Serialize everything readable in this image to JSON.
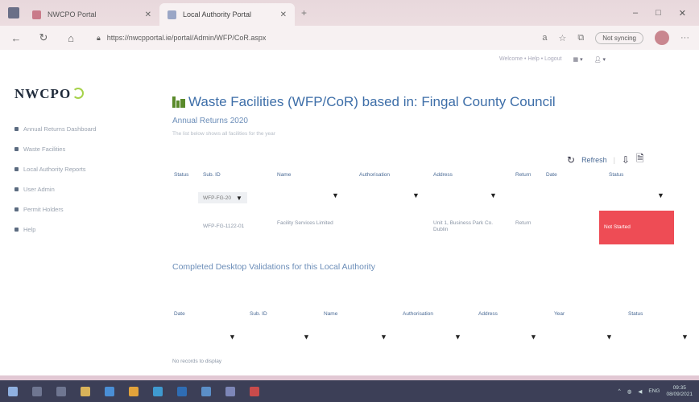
{
  "browser": {
    "tabs": [
      {
        "label": "NWCPO Portal"
      },
      {
        "label": "Local Authority Portal"
      }
    ],
    "url": "https://nwcpportal.ie/portal/Admin/WFP/CoR.aspx",
    "not_syncing": "Not syncing"
  },
  "header_links": "Welcome • Help • Logout",
  "logo": "NWCPO",
  "sidebar": {
    "items": [
      {
        "label": "Annual Returns Dashboard"
      },
      {
        "label": "Waste Facilities"
      },
      {
        "label": "Local Authority Reports"
      },
      {
        "label": "User Admin"
      },
      {
        "label": "Permit Holders"
      },
      {
        "label": "Help"
      }
    ]
  },
  "main": {
    "title": "Waste Facilities (WFP/CoR) based in: Fingal County Council",
    "subtitle": "Annual Returns 2020",
    "description": "The list below shows all facilities for the year",
    "toolbar": {
      "refresh": "Refresh"
    },
    "table1": {
      "columns": [
        "Status",
        "Sub. ID",
        "Name",
        "Authorisation",
        "Address",
        "Return",
        "Date",
        "Status"
      ],
      "filter_value": "WFP-FG-20",
      "row": {
        "c1": "",
        "id": "WFP-FG-1122-01",
        "name": "Facility Services Limited",
        "authorisation": "",
        "address": "Unit 1, Business Park Co. Dublin",
        "return": "Return",
        "date": "",
        "status": "Not Started"
      }
    },
    "section2_title": "Completed Desktop Validations for this Local Authority",
    "table2": {
      "columns": [
        "Date",
        "Sub. ID",
        "Name",
        "Authorisation",
        "Address",
        "Year",
        "Status"
      ]
    },
    "no_records": "No records to display"
  },
  "taskbar": {
    "time": "09:35",
    "date": "08/09/2021"
  },
  "colors": {
    "accent": "#3d6ea8",
    "status_red": "#ee4c55",
    "taskbar": "#3c3f57"
  }
}
